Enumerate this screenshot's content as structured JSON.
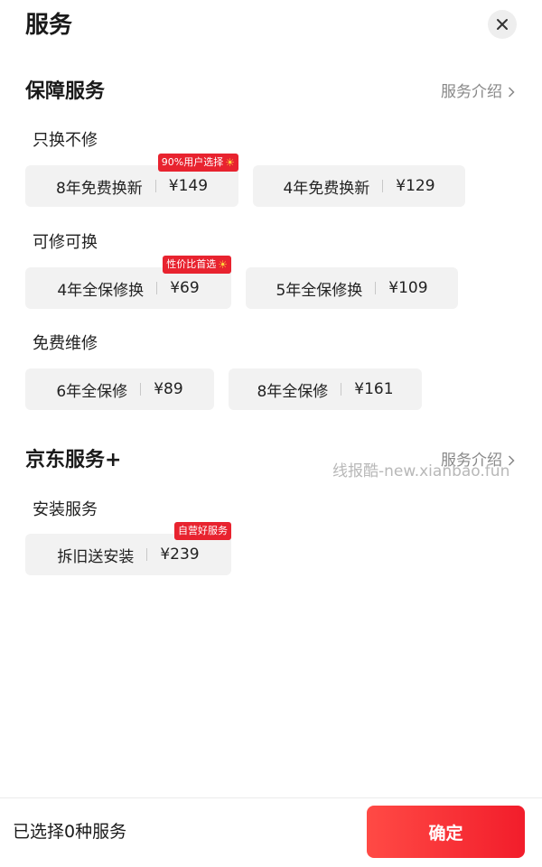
{
  "header": {
    "title": "服务"
  },
  "sections": {
    "protection": {
      "title": "保障服务",
      "intro": "服务介绍",
      "groups": [
        {
          "label": "只换不修",
          "options": [
            {
              "name": "8年免费换新",
              "price": "¥149",
              "badge": "90%用户选择"
            },
            {
              "name": "4年免费换新",
              "price": "¥129"
            }
          ]
        },
        {
          "label": "可修可换",
          "options": [
            {
              "name": "4年全保修换",
              "price": "¥69",
              "badge": "性价比首选"
            },
            {
              "name": "5年全保修换",
              "price": "¥109"
            }
          ]
        },
        {
          "label": "免费维修",
          "options": [
            {
              "name": "6年全保修",
              "price": "¥89"
            },
            {
              "name": "8年全保修",
              "price": "¥161"
            }
          ]
        }
      ]
    },
    "jd_plus": {
      "title": "京东服务+",
      "intro": "服务介绍",
      "groups": [
        {
          "label": "安装服务",
          "options": [
            {
              "name": "拆旧送安装",
              "price": "¥239",
              "badge": "自营好服务"
            }
          ]
        }
      ]
    }
  },
  "watermark": "线报酷-new.xianbao.fun",
  "footer": {
    "selected_text": "已选择0种服务",
    "confirm_label": "确定"
  },
  "colors": {
    "accent": "#e8232f",
    "chip_bg": "#f2f2f2",
    "muted": "#888888"
  }
}
